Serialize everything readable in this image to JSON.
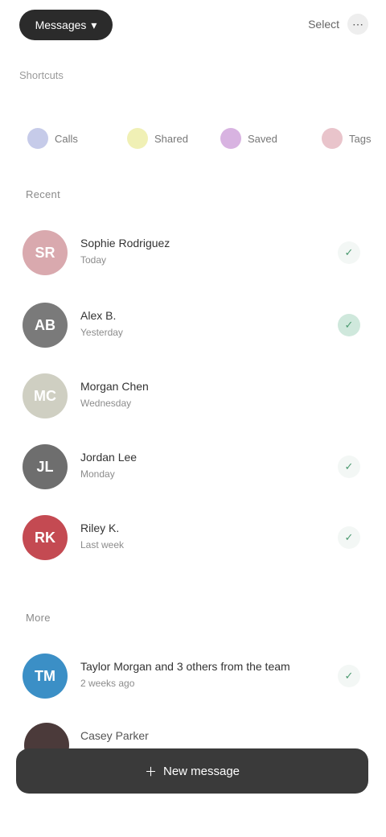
{
  "topbar": {
    "pill_label": "Messages",
    "pill_icon": "chevron-down-icon",
    "actions_label": "Select",
    "actions_icon": "more-icon"
  },
  "subhead": "Shortcuts",
  "filters": [
    {
      "label": "Calls",
      "color": "#5c6bc0"
    },
    {
      "label": "Shared",
      "color": "#d4d42a"
    },
    {
      "label": "Saved",
      "color": "#8e24aa"
    },
    {
      "label": "Tags",
      "color": "#c0566b"
    }
  ],
  "sections": {
    "recent": "Recent",
    "more": "More"
  },
  "contacts": [
    {
      "initials": "SR",
      "name": "Sophie Rodriguez",
      "detail": "Today",
      "avatar_color": "#d9a9ae",
      "status": "off"
    },
    {
      "initials": "AB",
      "name": "Alex B.",
      "detail": "Yesterday",
      "avatar_color": "#7a7a7a",
      "status": "on"
    },
    {
      "initials": "MC",
      "name": "Morgan Chen",
      "detail": "Wednesday",
      "avatar_color": "#cfcfc2",
      "status": "off"
    },
    {
      "initials": "JL",
      "name": "Jordan Lee",
      "detail": "Monday",
      "avatar_color": "#6e6e6e",
      "status": "off"
    },
    {
      "initials": "RK",
      "name": "Riley K.",
      "detail": "Last week",
      "avatar_color": "#c44a52",
      "status": "off"
    }
  ],
  "more_contact": {
    "initials": "TM",
    "name": "Taylor Morgan and 3 others from the team",
    "detail": "2 weeks ago",
    "avatar_color": "#3b8fc6",
    "status": "off"
  },
  "partial_contact": {
    "name": "Casey Parker"
  },
  "bottom_bar": {
    "label": "New message",
    "icon": "plus-icon"
  }
}
